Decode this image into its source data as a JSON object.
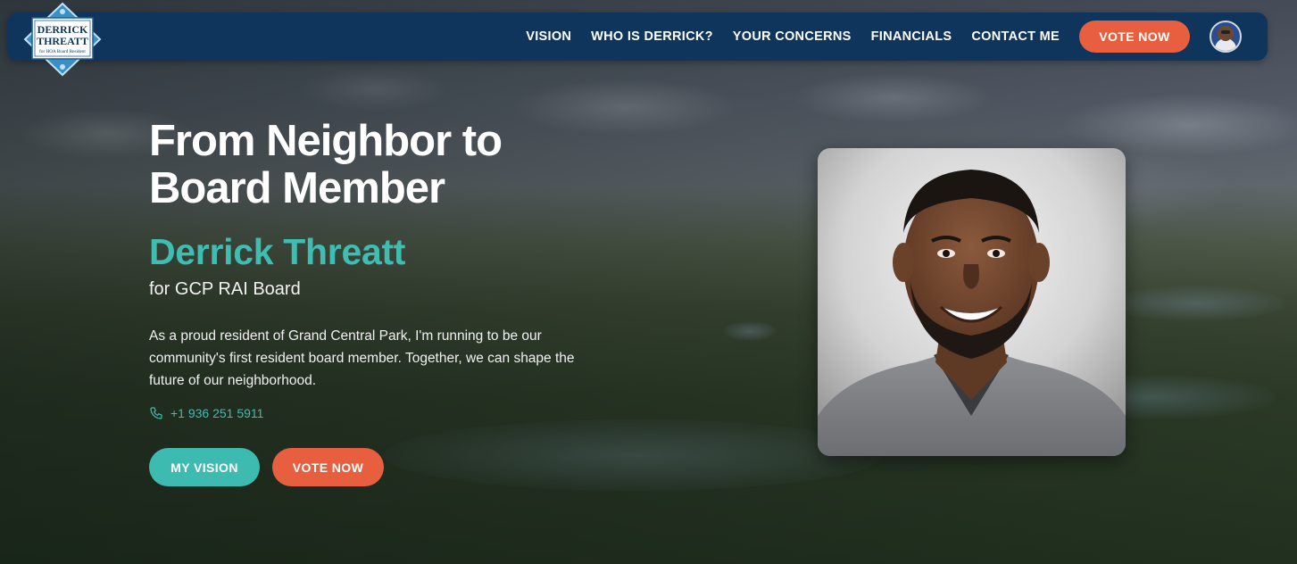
{
  "logo": {
    "line1": "DERRICK",
    "line2": "THREATT",
    "tagline": "for HOA Board Resident",
    "alt": "Derrick Threatt logo"
  },
  "nav": {
    "items": [
      {
        "label": "VISION"
      },
      {
        "label": "WHO IS DERRICK?"
      },
      {
        "label": "YOUR CONCERNS"
      },
      {
        "label": "FINANCIALS"
      },
      {
        "label": "CONTACT ME"
      }
    ],
    "cta_label": "VOTE NOW",
    "avatar_icon": "user-avatar-icon"
  },
  "hero": {
    "headline_line1": "From Neighbor to",
    "headline_line2": "Board Member",
    "name": "Derrick Threatt",
    "subtitle": "for GCP RAI Board",
    "description": "As a proud resident of Grand Central Park, I'm running to be our community's first resident board member. Together, we can shape the future of our neighborhood.",
    "phone": "+1 936 251 5911",
    "phone_icon": "phone-icon",
    "primary_button": "MY VISION",
    "secondary_button": "VOTE NOW"
  },
  "colors": {
    "nav_bg": "#0f355d",
    "accent_teal": "#3fbdb3",
    "accent_orange": "#e85f3f"
  }
}
